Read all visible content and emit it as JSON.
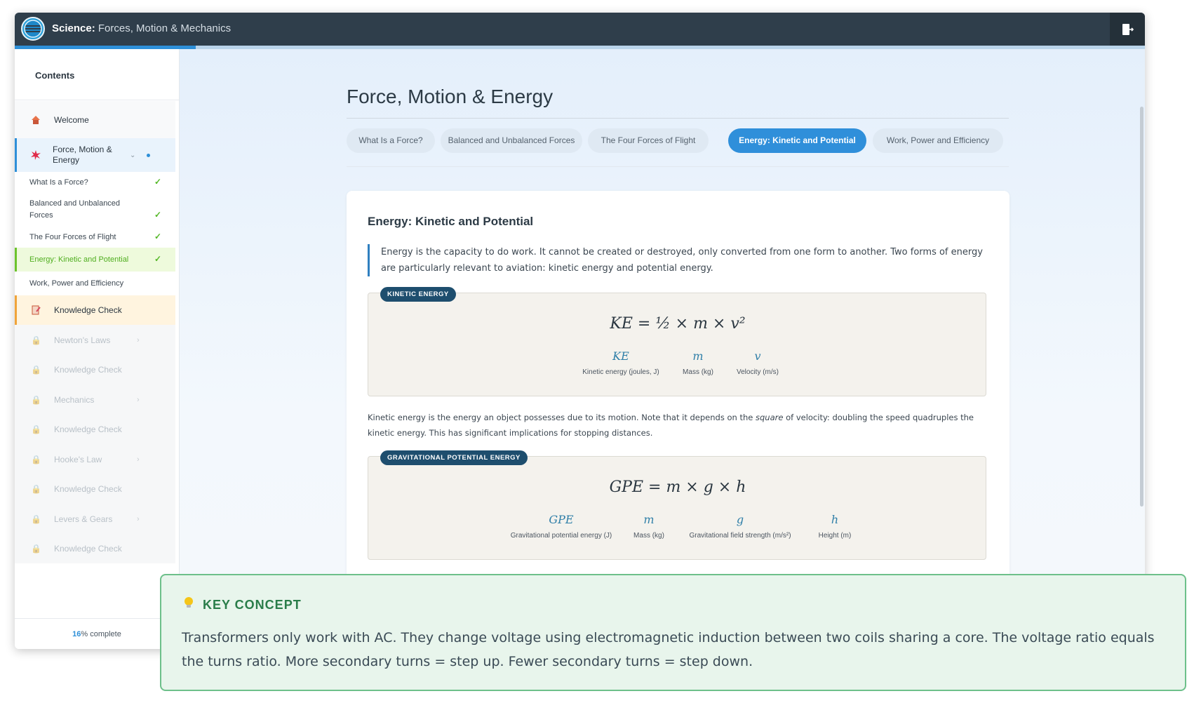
{
  "header": {
    "subject": "Science:",
    "course": "Forces, Motion & Mechanics",
    "exit_icon": "exit-door-icon",
    "progress_fraction": 0.16
  },
  "sidebar": {
    "title": "Contents",
    "welcome": "Welcome",
    "current_module": "Force, Motion & Energy",
    "sub_items": [
      {
        "label": "What Is a Force?",
        "done": true
      },
      {
        "label": "Balanced and Unbalanced Forces",
        "done": true
      },
      {
        "label": "The Four Forces of Flight",
        "done": true
      },
      {
        "label": "Energy: Kinetic and Potential",
        "done": true,
        "current": true
      },
      {
        "label": "Work, Power and Efficiency",
        "done": false
      }
    ],
    "knowledge_check": "Knowledge Check",
    "locked_items": [
      "Newton's Laws",
      "Knowledge Check",
      "Mechanics",
      "Knowledge Check",
      "Hooke's Law",
      "Knowledge Check",
      "Levers & Gears",
      "Knowledge Check"
    ],
    "progress_pct": "16",
    "progress_suffix": "% complete"
  },
  "main": {
    "title": "Force, Motion & Energy",
    "tabs": [
      "What Is a Force?",
      "Balanced and Unbalanced Forces",
      "The Four Forces of Flight",
      "Energy: Kinetic and Potential",
      "Work, Power and Efficiency"
    ],
    "active_tab": 3,
    "card": {
      "title": "Energy: Kinetic and Potential",
      "intro": "Energy is the capacity to do work. It cannot be created or destroyed, only converted from one form to another. Two forms of energy are particularly relevant to aviation: kinetic energy and potential energy.",
      "ke": {
        "badge": "KINETIC ENERGY",
        "formula": "KE = ½ × m × v²",
        "vars": [
          {
            "sym": "KE",
            "desc": "Kinetic energy (joules, J)"
          },
          {
            "sym": "m",
            "desc": "Mass (kg)"
          },
          {
            "sym": "v",
            "desc": "Velocity (m/s)"
          }
        ]
      },
      "para_a": "Kinetic energy is the energy an object possesses due to its motion. Note that it depends on the ",
      "para_em": "square",
      "para_b": " of velocity: doubling the speed quadruples the kinetic energy. This has significant implications for stopping distances.",
      "gpe": {
        "badge": "GRAVITATIONAL POTENTIAL ENERGY",
        "formula": "GPE = m × g × h",
        "vars": [
          {
            "sym": "GPE",
            "desc": "Gravitational potential energy (J)"
          },
          {
            "sym": "m",
            "desc": "Mass (kg)"
          },
          {
            "sym": "g",
            "desc": "Gravitational field strength (m/s²)"
          },
          {
            "sym": "h",
            "desc": "Height (m)"
          }
        ]
      }
    }
  },
  "key_concept": {
    "heading": "KEY CONCEPT",
    "icon": "lightbulb-icon",
    "text": "Transformers only work with AC. They change voltage using electromagnetic induction between two coils sharing a core. The voltage ratio equals the turns ratio. More secondary turns = step up. Fewer secondary turns = step down."
  }
}
